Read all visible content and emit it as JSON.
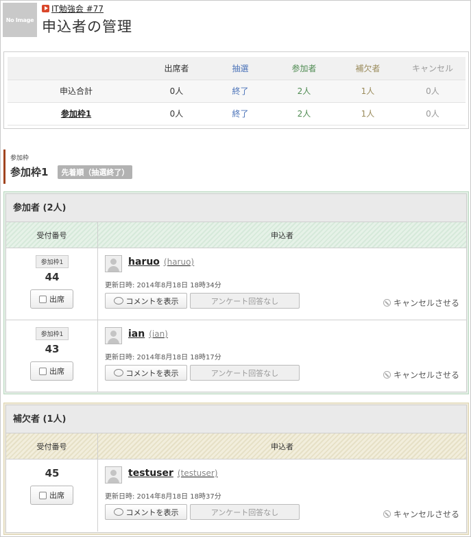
{
  "header": {
    "noimage_text": "No Image",
    "event_link": "IT勉強会 #77",
    "title": "申込者の管理"
  },
  "summary": {
    "columns": [
      "",
      "出席者",
      "抽選",
      "参加者",
      "補欠者",
      "キャンセル"
    ],
    "rows": [
      {
        "label": "申込合計",
        "attend": "0人",
        "lottery": "終了",
        "participants": "2人",
        "substitutes": "1人",
        "cancel": "0人"
      },
      {
        "label": "参加枠1",
        "attend": "0人",
        "lottery": "終了",
        "participants": "2人",
        "substitutes": "1人",
        "cancel": "0人"
      }
    ]
  },
  "frame": {
    "small_label": "参加枠",
    "name": "参加枠1",
    "badge": "先着順（抽選終了）"
  },
  "participants": {
    "title": "参加者 (2人)",
    "col_number": "受付番号",
    "col_applicant": "申込者",
    "rows": [
      {
        "tag": "参加枠1",
        "number": "44",
        "attend_label": "出席",
        "name": "haruo",
        "id": "(haruo)",
        "updated": "更新日時: 2014年8月18日 18時34分",
        "comment_label": "コメントを表示",
        "survey_label": "アンケート回答なし",
        "cancel_label": "キャンセルさせる"
      },
      {
        "tag": "参加枠1",
        "number": "43",
        "attend_label": "出席",
        "name": "ian",
        "id": "(ian)",
        "updated": "更新日時: 2014年8月18日 18時17分",
        "comment_label": "コメントを表示",
        "survey_label": "アンケート回答なし",
        "cancel_label": "キャンセルさせる"
      }
    ]
  },
  "substitutes": {
    "title": "補欠者 (1人)",
    "col_number": "受付番号",
    "col_applicant": "申込者",
    "rows": [
      {
        "number": "45",
        "attend_label": "出席",
        "name": "testuser",
        "id": "(testuser)",
        "updated": "更新日時: 2014年8月18日 18時37分",
        "comment_label": "コメントを表示",
        "survey_label": "アンケート回答なし",
        "cancel_label": "キャンセルさせる"
      }
    ]
  },
  "colors": {
    "lottery": "#4a72b8",
    "participants": "#4f8b52",
    "substitutes": "#9a8b5b",
    "cancel": "#999999",
    "frame_accent": "#a0441f"
  }
}
